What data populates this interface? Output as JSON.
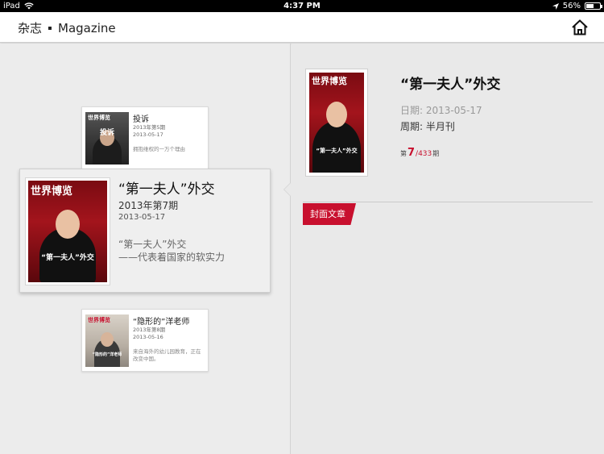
{
  "status_bar": {
    "device": "iPad",
    "time": "4:37 PM",
    "battery": "56%",
    "battery_level": 0.56,
    "icons": [
      "wifi-icon",
      "location-icon",
      "battery-icon"
    ]
  },
  "nav": {
    "title_cn": "杂志",
    "title_en": "Magazine",
    "home_icon": "home-icon"
  },
  "issues": [
    {
      "title": "投诉",
      "issue": "2013年第5期",
      "date": "2013-05-17",
      "desc": "拥抱维权的一万个理由",
      "cover_mast": "世界博览",
      "cover_headline": "投诉"
    },
    {
      "title": "“第一夫人”外交",
      "issue": "2013年第7期",
      "date": "2013-05-17",
      "desc_line1": "“第一夫人”外交",
      "desc_line2": "——代表着国家的软实力",
      "cover_mast": "世界博览",
      "cover_headline": "“第一夫人”外交"
    },
    {
      "title": "“隐形的”洋老师",
      "issue": "2013年第8期",
      "date": "2013-05-16",
      "desc": "来自海外的幼儿园教育，正在改变中国。",
      "cover_mast": "世界博览",
      "cover_headline": "“隐形的”洋老师"
    }
  ],
  "detail": {
    "title": "“第一夫人”外交",
    "date_label": "日期:",
    "date": "2013-05-17",
    "period_label": "周期:",
    "period": "半月刊",
    "issue_prefix": "第",
    "issue_current": "7",
    "issue_total": "/433",
    "issue_suffix": "期",
    "section_tag": "封面文章"
  },
  "colors": {
    "accent": "#c8102e",
    "background": "#e9e9e9",
    "navbar": "#ffffff"
  }
}
